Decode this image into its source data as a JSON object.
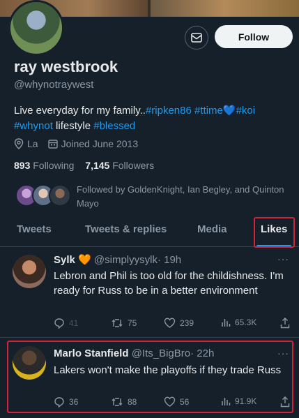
{
  "profile": {
    "name": "ray westbrook",
    "handle": "@whynotraywest",
    "follow_label": "Follow",
    "bio": [
      {
        "text": "Live everyday for my family..",
        "tag": false
      },
      {
        "text": "#ripken86",
        "tag": true
      },
      {
        "text": " ",
        "tag": false
      },
      {
        "text": "#ttime",
        "tag": true
      },
      {
        "text": "💙",
        "tag": false
      },
      {
        "text": "#koi",
        "tag": true
      },
      {
        "text": " ",
        "tag": false
      },
      {
        "text": "#whynot",
        "tag": true
      },
      {
        "text": " lifestyle ",
        "tag": false
      },
      {
        "text": "#blessed",
        "tag": true
      }
    ],
    "location": "La",
    "joined": "Joined June 2013",
    "following_count": "893",
    "following_label": "Following",
    "followers_count": "7,145",
    "followers_label": "Followers",
    "followed_by": "Followed by GoldenKnight, Ian Begley, and Quinton Mayo"
  },
  "tabs": [
    {
      "label": "Tweets",
      "active": false
    },
    {
      "label": "Tweets & replies",
      "active": false
    },
    {
      "label": "Media",
      "active": false
    },
    {
      "label": "Likes",
      "active": true
    }
  ],
  "tweets": [
    {
      "name": "Sylk",
      "emoji": "🧡",
      "handle": "@simplyysylk",
      "time": "· 19h",
      "text": "Lebron and Phil is too old for the childishness. I'm ready for Russ to be in a better environment",
      "replies": "41",
      "retweets": "75",
      "likes": "239",
      "views": "65.3K"
    },
    {
      "name": "Marlo Stanfield",
      "emoji": "",
      "handle": "@Its_BigBro",
      "time": "· 22h",
      "text": "Lakers won't make the playoffs if they trade Russ",
      "replies": "36",
      "retweets": "88",
      "likes": "56",
      "views": "91.9K"
    }
  ],
  "more_glyph": "···",
  "colors": {
    "background": "#15202b",
    "accent": "#1d9bf0",
    "highlight_box": "#d1243b",
    "secondary_text": "#8b98a5"
  }
}
